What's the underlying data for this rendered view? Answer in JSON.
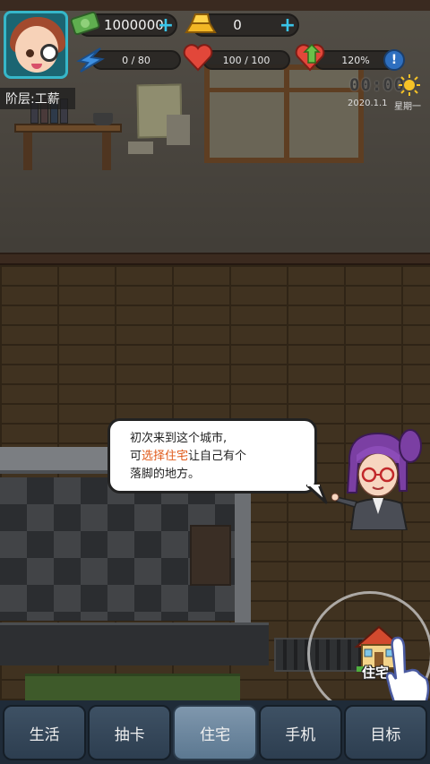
{
  "hud": {
    "money": "1000000",
    "gold": "0",
    "energy": "0 / 80",
    "health": "100 / 100",
    "mood": "120%",
    "info_label": "!",
    "rank": "阶层:工薪",
    "clock": "00:00",
    "date": "2020.1.1",
    "weekday": "星期一",
    "plus_label": "+"
  },
  "dialog": {
    "line1": "初次来到这个城市,",
    "line2_prefix": "可",
    "line2_highlight": "选择住宅",
    "line2_suffix": "让自己有个",
    "line3": "落脚的地方。"
  },
  "house_button": {
    "label": "住宅"
  },
  "tabs": [
    {
      "label": "生活"
    },
    {
      "label": "抽卡"
    },
    {
      "label": "住宅"
    },
    {
      "label": "手机"
    },
    {
      "label": "目标"
    }
  ],
  "colors": {
    "accent_plus": "#3ac4e8",
    "highlight": "#e05a1a",
    "tab_active": "#7f97ad",
    "tab_bar": "#1f2b38",
    "avatar_border": "#36b7c9"
  },
  "icons": [
    "money-icon",
    "gold-bar-icon",
    "energy-icon",
    "heart-icon",
    "mood-heart-icon",
    "info-icon",
    "sun-icon",
    "house-icon",
    "pointer-hand-icon"
  ]
}
